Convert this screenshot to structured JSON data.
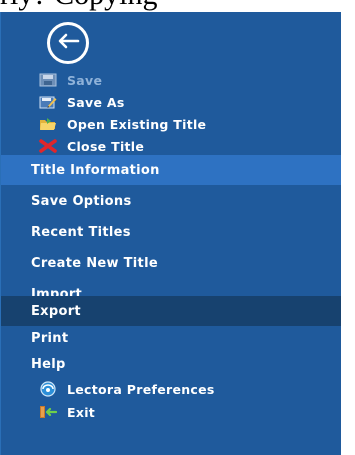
{
  "top_text": "rly? Copying",
  "back_button": {
    "icon": "back-arrow-icon"
  },
  "file_actions": [
    {
      "label": "Save",
      "icon": "save-icon",
      "disabled": true
    },
    {
      "label": "Save As",
      "icon": "save-as-icon",
      "disabled": false
    },
    {
      "label": "Open Existing Title",
      "icon": "open-folder-icon",
      "disabled": false
    },
    {
      "label": "Close Title",
      "icon": "close-x-icon",
      "disabled": false
    }
  ],
  "sections": [
    {
      "label": "Title Information",
      "selected": true
    },
    {
      "label": "Save Options"
    },
    {
      "label": "Recent Titles"
    },
    {
      "label": "Create New Title"
    },
    {
      "label": "Import"
    },
    {
      "label": "Export",
      "active": true
    }
  ],
  "bottom_items": [
    {
      "label": "Print"
    },
    {
      "label": "Help"
    },
    {
      "label": "Lectora Preferences",
      "icon": "preferences-icon"
    },
    {
      "label": "Exit",
      "icon": "exit-door-icon"
    }
  ],
  "colors": {
    "panel_bg": "#1f5a9c",
    "selected_bg": "#2e72c2",
    "active_bg": "#17426f",
    "text": "#ffffff",
    "disabled_text": "#8fb2d9"
  }
}
